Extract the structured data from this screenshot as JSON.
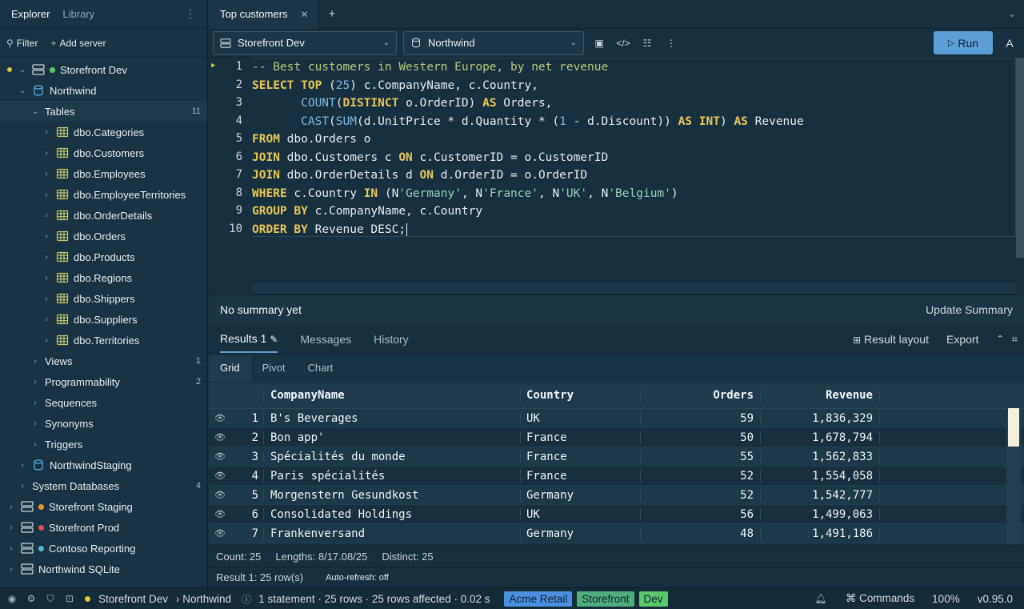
{
  "sidebar": {
    "tabs": [
      "Explorer",
      "Library"
    ],
    "filter_label": "Filter",
    "add_server_label": "Add server",
    "tree": {
      "storefront_dev": "Storefront Dev",
      "northwind": "Northwind",
      "tables": {
        "label": "Tables",
        "count": "11"
      },
      "table_items": [
        "dbo.Categories",
        "dbo.Customers",
        "dbo.Employees",
        "dbo.EmployeeTerritories",
        "dbo.OrderDetails",
        "dbo.Orders",
        "dbo.Products",
        "dbo.Regions",
        "dbo.Shippers",
        "dbo.Suppliers",
        "dbo.Territories"
      ],
      "views": {
        "label": "Views",
        "count": "1"
      },
      "programmability": {
        "label": "Programmability",
        "count": "2"
      },
      "sequences": "Sequences",
      "synonyms": "Synonyms",
      "triggers": "Triggers",
      "northwind_staging": "NorthwindStaging",
      "system_databases": {
        "label": "System Databases",
        "count": "4"
      },
      "servers": [
        {
          "name": "Storefront Staging",
          "color": "#e89a2c"
        },
        {
          "name": "Storefront Prod",
          "color": "#e0524a"
        },
        {
          "name": "Contoso Reporting",
          "color": "#4fb8d9"
        },
        {
          "name": "Northwind SQLite",
          "color": ""
        }
      ]
    }
  },
  "tabbar": {
    "tab_label": "Top customers"
  },
  "toolbar": {
    "server_select": "Storefront Dev",
    "database_select": "Northwind",
    "run_label": "Run",
    "a_label": "A"
  },
  "editor": {
    "line_numbers": [
      "1",
      "2",
      "3",
      "4",
      "5",
      "6",
      "7",
      "8",
      "9",
      "10"
    ]
  },
  "summary": {
    "text": "No summary yet",
    "update_label": "Update Summary"
  },
  "results": {
    "tabs": [
      "Results 1",
      "Messages",
      "History"
    ],
    "result_layout_label": "Result layout",
    "export_label": "Export",
    "subtabs": [
      "Grid",
      "Pivot",
      "Chart"
    ],
    "columns": [
      "CompanyName",
      "Country",
      "Orders",
      "Revenue"
    ],
    "rows": [
      {
        "n": "1",
        "company": "B's Beverages",
        "country": "UK",
        "orders": "59",
        "revenue": "1,836,329"
      },
      {
        "n": "2",
        "company": "Bon app'",
        "country": "France",
        "orders": "50",
        "revenue": "1,678,794"
      },
      {
        "n": "3",
        "company": "Spécialités du monde",
        "country": "France",
        "orders": "55",
        "revenue": "1,562,833"
      },
      {
        "n": "4",
        "company": "Paris spécialités",
        "country": "France",
        "orders": "52",
        "revenue": "1,554,058"
      },
      {
        "n": "5",
        "company": "Morgenstern Gesundkost",
        "country": "Germany",
        "orders": "52",
        "revenue": "1,542,777"
      },
      {
        "n": "6",
        "company": "Consolidated Holdings",
        "country": "UK",
        "orders": "56",
        "revenue": "1,499,063"
      },
      {
        "n": "7",
        "company": "Frankenversand",
        "country": "Germany",
        "orders": "48",
        "revenue": "1,491,186"
      }
    ],
    "stats": {
      "count": "Count: 25",
      "lengths": "Lengths: 8/17.08/25",
      "distinct": "Distinct: 25"
    },
    "footer": {
      "rows": "Result 1: 25 row(s)",
      "autorefresh": "Auto-refresh: off"
    }
  },
  "status": {
    "server": "Storefront Dev",
    "database": "› Northwind",
    "info": "1 statement · 25 rows · 25 rows affected · 0.02 s",
    "badges": [
      {
        "label": "Acme Retail",
        "color": "#4a8fe0"
      },
      {
        "label": "Storefront",
        "color": "#4fae7e"
      },
      {
        "label": "Dev",
        "color": "#5cc86c"
      }
    ],
    "commands_label": "Commands",
    "zoom": "100%",
    "version": "v0.95.0"
  }
}
